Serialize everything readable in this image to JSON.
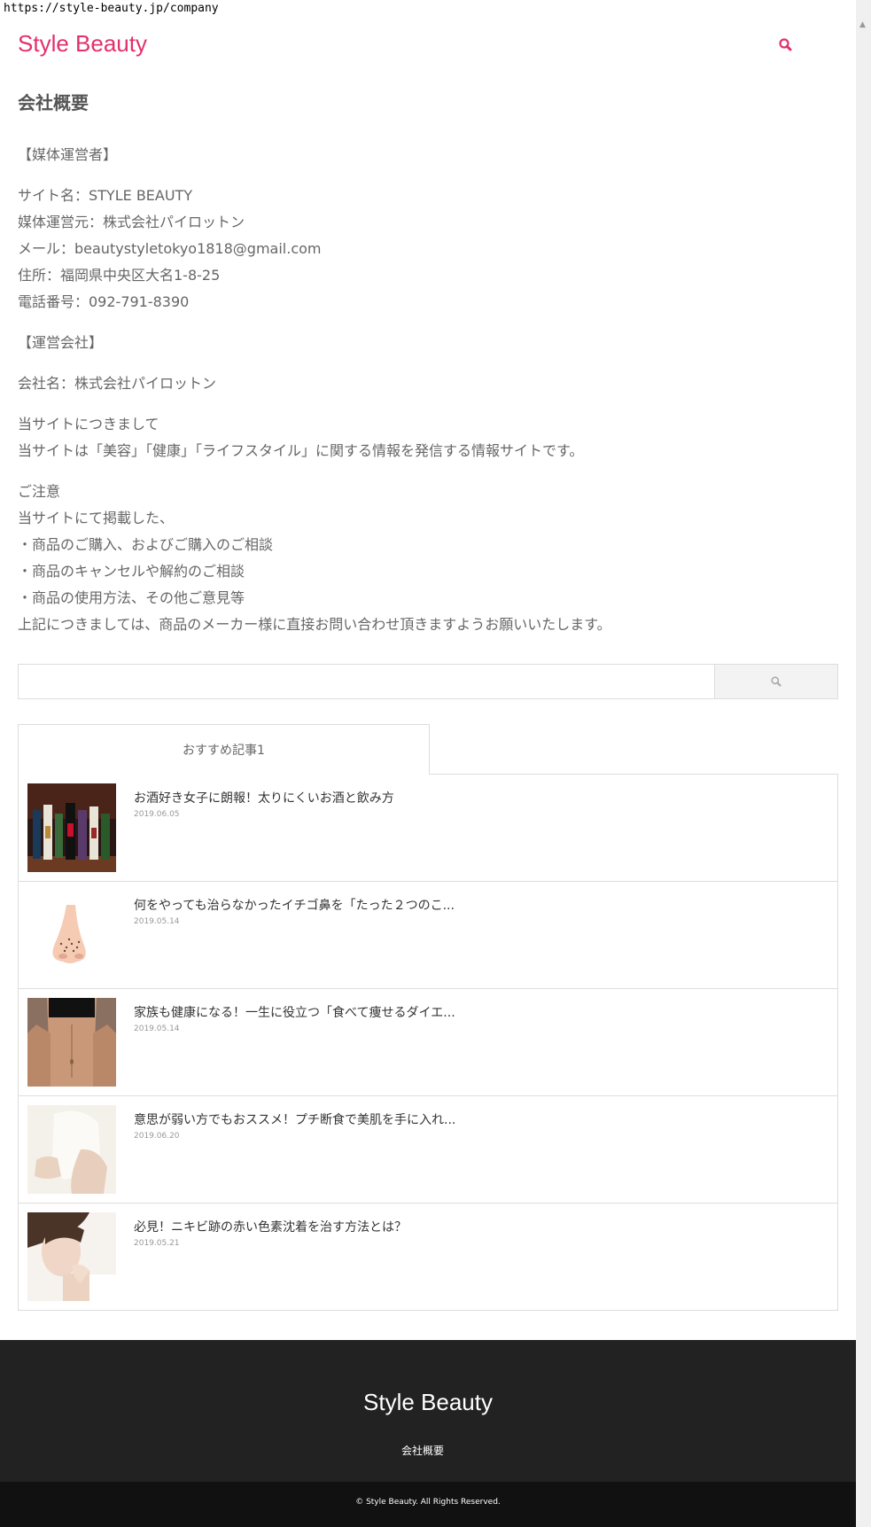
{
  "browser": {
    "url": "https://style-beauty.jp/company"
  },
  "header": {
    "site_title": "Style Beauty"
  },
  "main": {
    "page_title": "会社概要",
    "content": {
      "media_operator_heading": "【媒体運営者】",
      "site_name": "サイト名：STYLE BEAUTY",
      "operator": "媒体運営元：株式会社パイロットン",
      "email": "メール：beautystyletokyo1818@gmail.com",
      "address": "住所：福岡県中央区大名1-8-25",
      "phone": "電話番号：092-791-8390",
      "company_heading": "【運営会社】",
      "company_name": "会社名：株式会社パイロットン",
      "about_heading": "当サイトにつきまして",
      "about_text": "当サイトは「美容」「健康」「ライフスタイル」に関する情報を発信する情報サイトです。",
      "notice_heading": "ご注意",
      "notice_intro": "当サイトにて掲載した、",
      "notice_item_1": "・商品のご購入、およびご購入のご相談",
      "notice_item_2": "・商品のキャンセルや解約のご相談",
      "notice_item_3": "・商品の使用方法、その他ご意見等",
      "notice_outro": "上記につきましては、商品のメーカー様に直接お問い合わせ頂きますようお願いいたします。"
    }
  },
  "search": {
    "placeholder": ""
  },
  "recommended": {
    "tab_label": "おすすめ記事1",
    "articles": [
      {
        "title": "お酒好き女子に朗報！太りにくいお酒と飲み方",
        "date": "2019.06.05",
        "thumb": "sake-bottles"
      },
      {
        "title": "何をやっても治らなかったイチゴ鼻を「たった２つのこ...",
        "date": "2019.05.14",
        "thumb": "nose-illustration"
      },
      {
        "title": "家族も健康になる！一生に役立つ「食べて痩せるダイエ...",
        "date": "2019.05.14",
        "thumb": "fit-waist"
      },
      {
        "title": "意思が弱い方でもおススメ！プチ断食で美肌を手に入れ...",
        "date": "2019.06.20",
        "thumb": "woman-white"
      },
      {
        "title": "必見！ニキビ跡の赤い色素沈着を治す方法とは？",
        "date": "2019.05.21",
        "thumb": "woman-skin"
      }
    ]
  },
  "footer": {
    "site_title": "Style Beauty",
    "company_link": "会社概要",
    "copyright": "© Style Beauty. All Rights Reserved."
  },
  "colors": {
    "brand": "#e2306c",
    "footer_bg": "#222222",
    "copyright_bg": "#111111"
  }
}
